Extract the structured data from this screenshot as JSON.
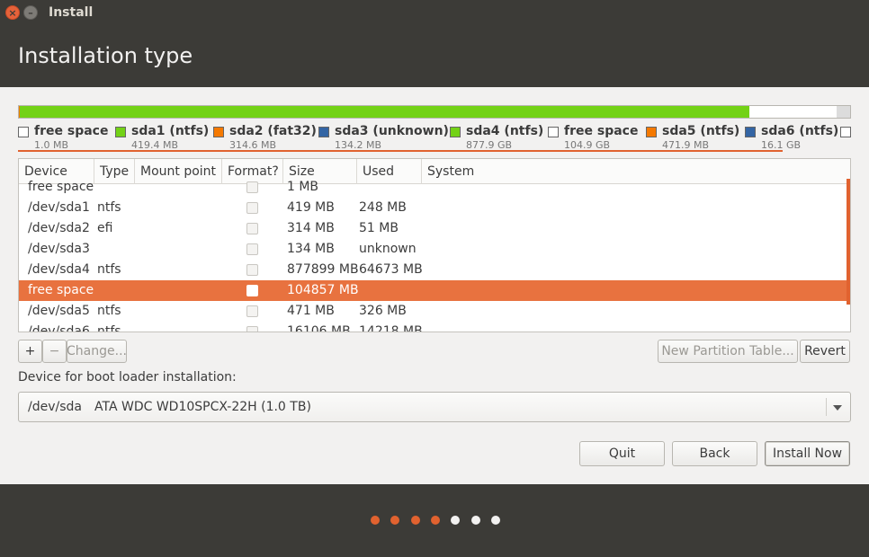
{
  "window": {
    "title": "Install",
    "close_glyph": "×",
    "min_glyph": "–"
  },
  "header": {
    "title": "Installation type"
  },
  "partition_bar": {
    "segments": [
      {
        "name": "free space",
        "fraction": 0.0,
        "color": "#ffffff"
      },
      {
        "name": "sda1",
        "fraction": 0.0004,
        "color": "#73d216"
      },
      {
        "name": "sda2",
        "fraction": 0.0003,
        "color": "#f57900"
      },
      {
        "name": "sda3",
        "fraction": 0.0001,
        "color": "#3465a4"
      },
      {
        "name": "sda4",
        "fraction": 0.8778,
        "color": "#73d216"
      },
      {
        "name": "free space",
        "fraction": 0.1049,
        "color": "#ffffff"
      },
      {
        "name": "sda5",
        "fraction": 0.0005,
        "color": "#f57900"
      },
      {
        "name": "sda6",
        "fraction": 0.0161,
        "color": "#dcdcdc"
      }
    ]
  },
  "legend": [
    {
      "name": "free space",
      "size": "1.0 MB",
      "color": "#ffffff"
    },
    {
      "name": "sda1 (ntfs)",
      "size": "419.4 MB",
      "color": "#73d216"
    },
    {
      "name": "sda2 (fat32)",
      "size": "314.6 MB",
      "color": "#f57900"
    },
    {
      "name": "sda3 (unknown)",
      "size": "134.2 MB",
      "color": "#3465a4"
    },
    {
      "name": "sda4 (ntfs)",
      "size": "877.9 GB",
      "color": "#73d216"
    },
    {
      "name": "free space",
      "size": "104.9 GB",
      "color": "#ffffff"
    },
    {
      "name": "sda5 (ntfs)",
      "size": "471.9 MB",
      "color": "#f57900"
    },
    {
      "name": "sda6 (ntfs)",
      "size": "16.1 GB",
      "color": "#3465a4"
    }
  ],
  "table": {
    "columns": [
      "Device",
      "Type",
      "Mount point",
      "Format?",
      "Size",
      "Used",
      "System"
    ],
    "rows": [
      {
        "device": "free space",
        "type": "",
        "mount": "",
        "size": "1 MB",
        "used": "",
        "system": ""
      },
      {
        "device": "/dev/sda1",
        "type": "ntfs",
        "mount": "",
        "size": "419 MB",
        "used": "248 MB",
        "system": ""
      },
      {
        "device": "/dev/sda2",
        "type": "efi",
        "mount": "",
        "size": "314 MB",
        "used": "51 MB",
        "system": ""
      },
      {
        "device": "/dev/sda3",
        "type": "",
        "mount": "",
        "size": "134 MB",
        "used": "unknown",
        "system": ""
      },
      {
        "device": "/dev/sda4",
        "type": "ntfs",
        "mount": "",
        "size": "877899 MB",
        "used": "64673 MB",
        "system": ""
      },
      {
        "device": "free space",
        "type": "",
        "mount": "",
        "size": "104857 MB",
        "used": "",
        "system": "",
        "selected": true
      },
      {
        "device": "/dev/sda5",
        "type": "ntfs",
        "mount": "",
        "size": "471 MB",
        "used": "326 MB",
        "system": ""
      },
      {
        "device": "/dev/sda6",
        "type": "ntfs",
        "mount": "",
        "size": "16106 MB",
        "used": "14218 MB",
        "system": ""
      }
    ]
  },
  "toolbar": {
    "add_label": "+",
    "remove_label": "−",
    "change_label": "Change...",
    "new_table_label": "New Partition Table...",
    "revert_label": "Revert"
  },
  "bootloader": {
    "label": "Device for boot loader installation:",
    "device": "/dev/sda",
    "description": "ATA WDC WD10SPCX-22H (1.0 TB)"
  },
  "buttons": {
    "quit": "Quit",
    "back": "Back",
    "install": "Install Now"
  },
  "progress": {
    "steps_done": 4,
    "steps_total": 7,
    "done_color": "#e1622f",
    "todo_color": "#f2f1f0"
  }
}
